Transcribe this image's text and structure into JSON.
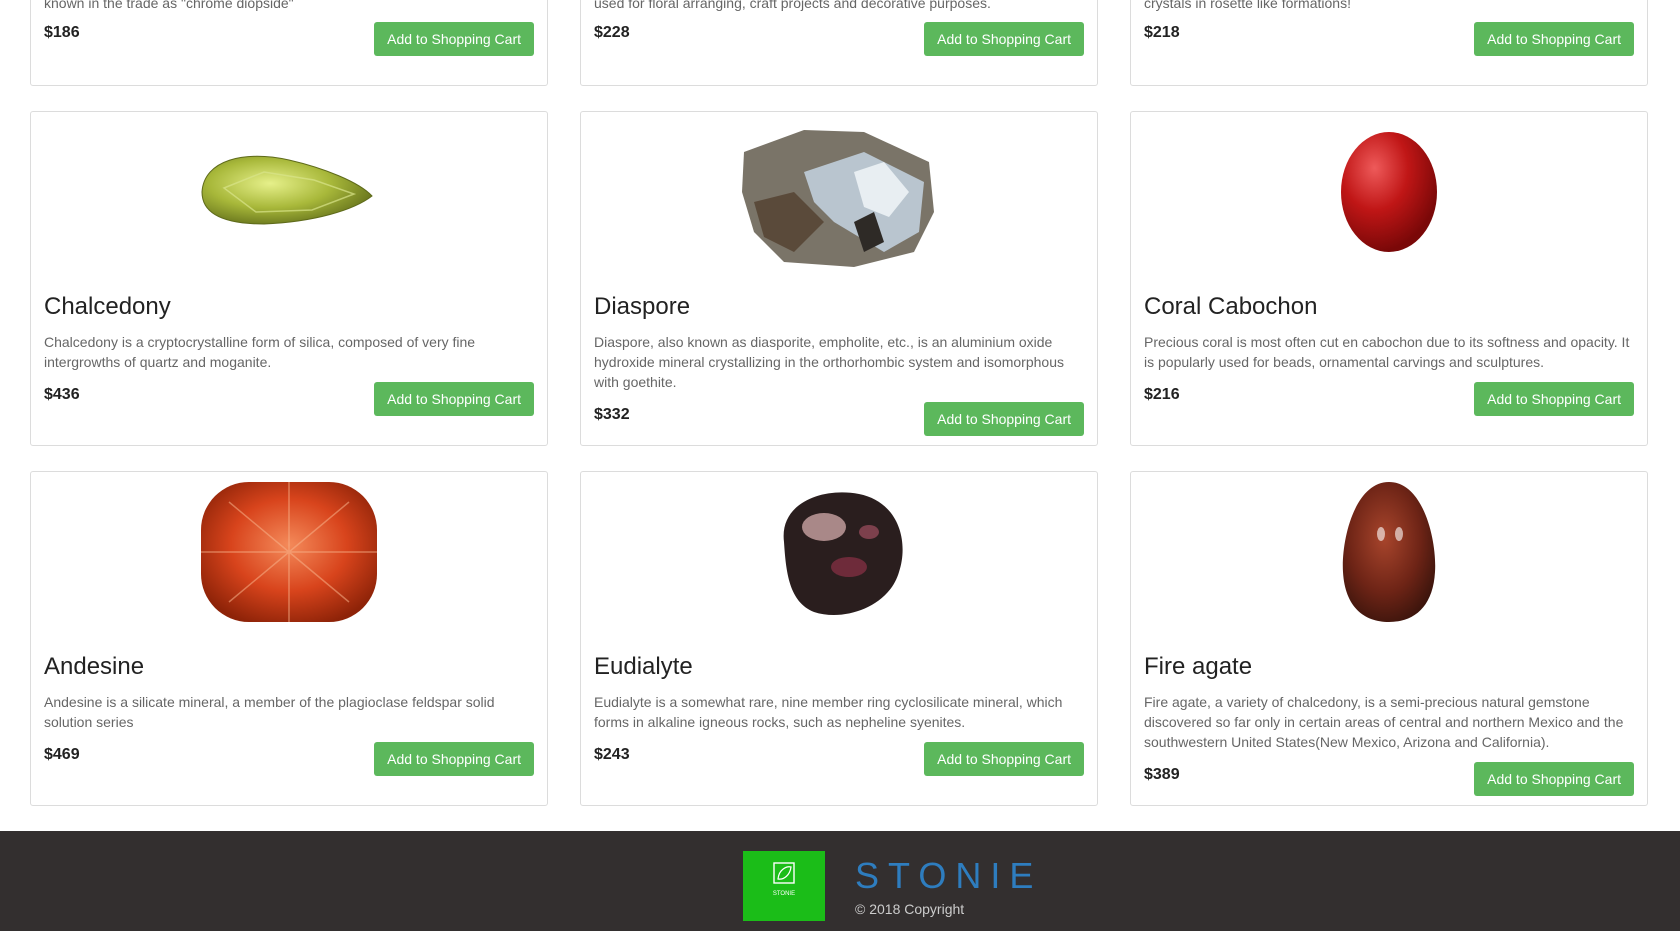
{
  "products": [
    {
      "name": "",
      "desc": "known in the trade as \"chrome diopside\"",
      "price": "$186",
      "button": "Add to Shopping Cart"
    },
    {
      "name": "",
      "desc": "used for floral arranging, craft projects and decorative purposes.",
      "price": "$228",
      "button": "Add to Shopping Cart"
    },
    {
      "name": "",
      "desc": "crystals in rosette like formations!",
      "price": "$218",
      "button": "Add to Shopping Cart"
    },
    {
      "name": "Chalcedony",
      "desc": "Chalcedony is a cryptocrystalline form of silica, composed of very fine intergrowths of quartz and moganite.",
      "price": "$436",
      "button": "Add to Shopping Cart"
    },
    {
      "name": "Diaspore",
      "desc": "Diaspore, also known as diasporite, empholite, etc., is an aluminium oxide hydroxide mineral crystallizing in the orthorhombic system and isomorphous with goethite.",
      "price": "$332",
      "button": "Add to Shopping Cart"
    },
    {
      "name": "Coral Cabochon",
      "desc": "Precious coral is most often cut en cabochon due to its softness and opacity. It is popularly used for beads, ornamental carvings and sculptures.",
      "price": "$216",
      "button": "Add to Shopping Cart"
    },
    {
      "name": "Andesine",
      "desc": "Andesine is a silicate mineral, a member of the plagioclase feldspar solid solution series",
      "price": "$469",
      "button": "Add to Shopping Cart"
    },
    {
      "name": "Eudialyte",
      "desc": "Eudialyte is a somewhat rare, nine member ring cyclosilicate mineral, which forms in alkaline igneous rocks, such as nepheline syenites.",
      "price": "$243",
      "button": "Add to Shopping Cart"
    },
    {
      "name": "Fire agate",
      "desc": "Fire agate, a variety of chalcedony, is a semi-precious natural gemstone discovered so far only in certain areas of central and northern Mexico and the southwestern United States(New Mexico, Arizona and California).",
      "price": "$389",
      "button": "Add to Shopping Cart"
    }
  ],
  "footer": {
    "brand": "STONIE",
    "copyright": "© 2018 Copyright",
    "logo_icon": "leaf-logo-icon",
    "logo_text": "STONIE"
  },
  "colors": {
    "button": "#5cb85c",
    "footer_bg": "#332f2f",
    "brand": "#2e7dbf",
    "logo_bg": "#1bbd18"
  }
}
